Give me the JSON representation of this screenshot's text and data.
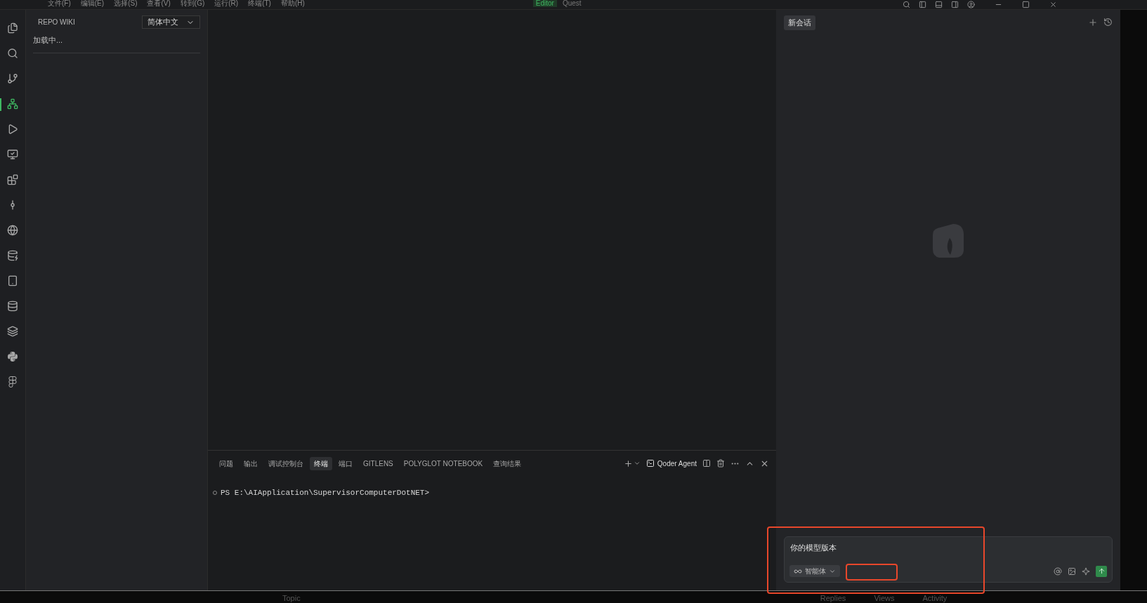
{
  "menu_bar": {
    "items": [
      "文件(F)",
      "编辑(E)",
      "选择(S)",
      "查看(V)",
      "转到(G)",
      "运行(R)",
      "终端(T)",
      "帮助(H)"
    ],
    "modes": [
      {
        "label": "Editor",
        "selected": true
      },
      {
        "label": "Quest",
        "selected": false
      }
    ]
  },
  "activity_bar": {
    "items": [
      {
        "selected": false
      },
      {
        "selected": false
      },
      {
        "selected": false
      },
      {
        "selected": true
      },
      {
        "selected": false
      },
      {
        "selected": false
      },
      {
        "selected": false
      },
      {
        "selected": false
      },
      {
        "selected": false
      },
      {
        "selected": false
      },
      {
        "selected": false
      },
      {
        "selected": false
      },
      {
        "selected": false
      },
      {
        "selected": false
      },
      {
        "selected": false
      }
    ]
  },
  "sidebar": {
    "title": "REPO WIKI",
    "language": "简体中文",
    "status": "加载中..."
  },
  "panel": {
    "tabs": [
      {
        "label": "问题",
        "selected": false
      },
      {
        "label": "输出",
        "selected": false
      },
      {
        "label": "调试控制台",
        "selected": false
      },
      {
        "label": "终端",
        "selected": true
      },
      {
        "label": "端口",
        "selected": false
      },
      {
        "label": "GITLENS",
        "selected": false
      },
      {
        "label": "POLYGLOT NOTEBOOK",
        "selected": false
      },
      {
        "label": "查询结果",
        "selected": false
      }
    ],
    "terminal_name": "Qoder Agent",
    "prompt": "PS E:\\AIApplication\\SupervisorComputerDotNET>"
  },
  "chat": {
    "session_tab": "新会话",
    "input_value": "你的模型版本",
    "mode": "智能体"
  },
  "background_page": {
    "columns": [
      "Topic",
      "Replies",
      "Views",
      "Activity"
    ]
  }
}
